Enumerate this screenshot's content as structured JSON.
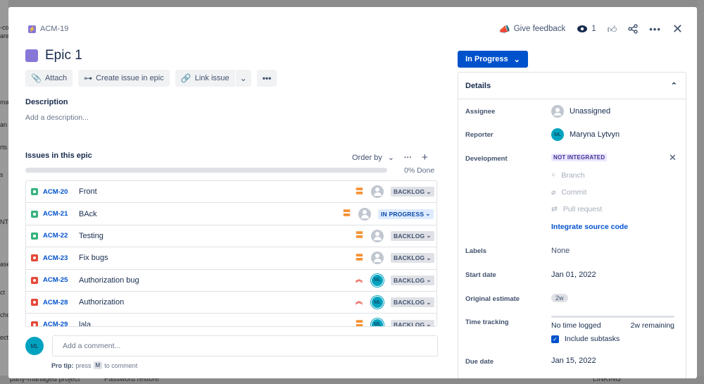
{
  "background": {
    "left_fragments": [
      "-co",
      "are",
      "ma",
      "an",
      "rts",
      "s",
      "NT",
      "ase",
      "ct",
      "cho",
      "ect"
    ],
    "bottom_texts": [
      "pany-managed project",
      "Password restore",
      "LINKING"
    ]
  },
  "header": {
    "issue_key": "ACM-19",
    "title": "Epic 1",
    "feedback_label": "Give feedback",
    "watch_count": "1"
  },
  "toolbar": {
    "attach": "Attach",
    "create_issue": "Create issue in epic",
    "link_issue": "Link issue"
  },
  "description": {
    "heading": "Description",
    "placeholder": "Add a description..."
  },
  "issues": {
    "heading": "Issues in this epic",
    "order_by": "Order by",
    "progress_percent": 0,
    "progress_text": "0% Done",
    "rows": [
      {
        "type": "story",
        "key": "ACM-20",
        "summary": "Front",
        "priority": "medium",
        "assignee": "unassigned",
        "status": "BACKLOG"
      },
      {
        "type": "story",
        "key": "ACM-21",
        "summary": "BAck",
        "priority": "medium",
        "assignee": "unassigned",
        "status": "IN PROGRESS"
      },
      {
        "type": "story",
        "key": "ACM-22",
        "summary": "Testing",
        "priority": "medium",
        "assignee": "unassigned",
        "status": "BACKLOG"
      },
      {
        "type": "bug",
        "key": "ACM-23",
        "summary": "Fix bugs",
        "priority": "medium",
        "assignee": "unassigned",
        "status": "BACKLOG"
      },
      {
        "type": "bug",
        "key": "ACM-25",
        "summary": "Authorization bug",
        "priority": "high",
        "assignee": "ML",
        "status": "BACKLOG"
      },
      {
        "type": "bug",
        "key": "ACM-28",
        "summary": "Authorization",
        "priority": "high",
        "assignee": "ML",
        "status": "BACKLOG"
      },
      {
        "type": "bug",
        "key": "ACM-29",
        "summary": "lala",
        "priority": "medium",
        "assignee": "ML",
        "status": "BACKLOG"
      }
    ]
  },
  "comment": {
    "avatar": "ML",
    "placeholder": "Add a comment...",
    "tip_prefix": "Pro tip:",
    "tip_press": "press",
    "tip_key": "M",
    "tip_suffix": "to comment"
  },
  "status_button": "In Progress",
  "details": {
    "heading": "Details",
    "assignee_label": "Assignee",
    "assignee_value": "Unassigned",
    "reporter_label": "Reporter",
    "reporter_avatar": "ML",
    "reporter_value": "Maryna Lytvyn",
    "development_label": "Development",
    "development_badge": "NOT INTEGRATED",
    "branch": "Branch",
    "commit": "Commit",
    "pull_request": "Pull request",
    "integrate_link": "Integrate source code",
    "labels_label": "Labels",
    "labels_value": "None",
    "start_date_label": "Start date",
    "start_date_value": "Jan 01, 2022",
    "estimate_label": "Original estimate",
    "estimate_value": "2w",
    "time_tracking_label": "Time tracking",
    "time_logged": "No time logged",
    "time_remaining": "2w remaining",
    "include_subtasks": "Include subtasks",
    "due_date_label": "Due date",
    "due_date_value": "Jan 15, 2022"
  }
}
